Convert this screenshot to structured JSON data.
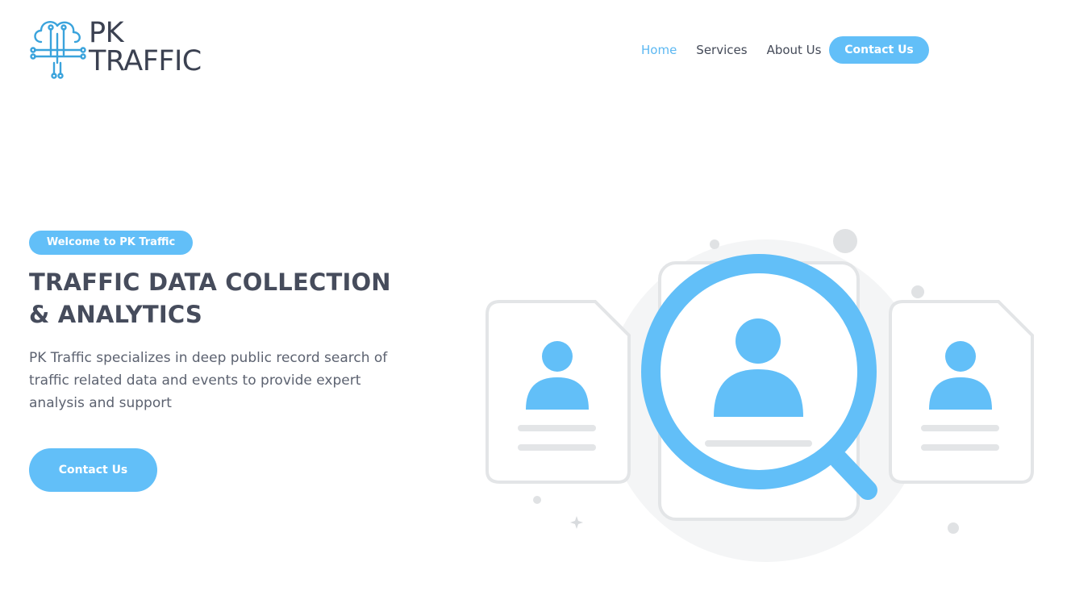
{
  "brand": {
    "line1": "PK",
    "line2": "TRAFFIC",
    "accent_color": "#62bff8",
    "text_color": "#3b4151",
    "logo_icon": "cloud-circuit-icon"
  },
  "nav": {
    "items": [
      {
        "label": "Home",
        "active": true
      },
      {
        "label": "Services",
        "active": false
      },
      {
        "label": "About Us",
        "active": false
      }
    ],
    "cta_label": "Contact Us"
  },
  "hero": {
    "badge": "Welcome to PK Traffic",
    "title": "TRAFFIC DATA COLLECTION & ANALYTICS",
    "description": "PK Traffic specializes in deep public record search of traffic related data and events to provide expert analysis and support",
    "cta_label": "Contact Us"
  },
  "illustration": {
    "icon": "profile-search-icon",
    "primary_color": "#62bff8",
    "outline_color": "#e3e5e7"
  }
}
